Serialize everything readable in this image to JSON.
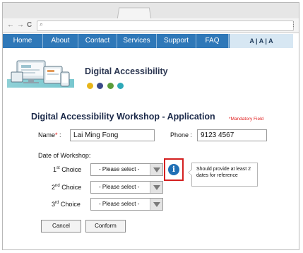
{
  "browser": {
    "back_glyph": "←",
    "forward_glyph": "→",
    "reload_glyph": "C",
    "search_glyph": "⌕",
    "menu_glyph": "⋮"
  },
  "nav": {
    "items": [
      "Home",
      "About",
      "Contact",
      "Services",
      "Support",
      "FAQ"
    ],
    "font_sizes": "A | A | A"
  },
  "banner": {
    "title": "Digital Accessibility"
  },
  "form": {
    "title": "Digital Accessibility Workshop - Application",
    "mandatory_note": "*Mandatory Field",
    "name_label": "Name",
    "name_star": "*",
    "name_colon": ":",
    "name_value": "Lai Ming Fong",
    "phone_label": "Phone :",
    "phone_value": "9123 4567",
    "date_label": "Date of Workshop:",
    "choices": [
      {
        "num": "1",
        "sup": "st",
        "label": " Choice",
        "value": "- Please select -"
      },
      {
        "num": "2",
        "sup": "nd",
        "label": " Choice",
        "value": "- Please select -"
      },
      {
        "num": "3",
        "sup": "rd",
        "label": " Choice",
        "value": "- Please select -"
      }
    ],
    "info_glyph": "i",
    "tooltip": "Should provide at least 2 dates for reference",
    "cancel_label": "Cancel",
    "conform_label": "Conform"
  },
  "colors": {
    "nav_bg": "#2f78b8",
    "accent_red": "#e01b1b",
    "info_blue": "#1f6fb5",
    "banner_teal": "#2ea9b8"
  }
}
